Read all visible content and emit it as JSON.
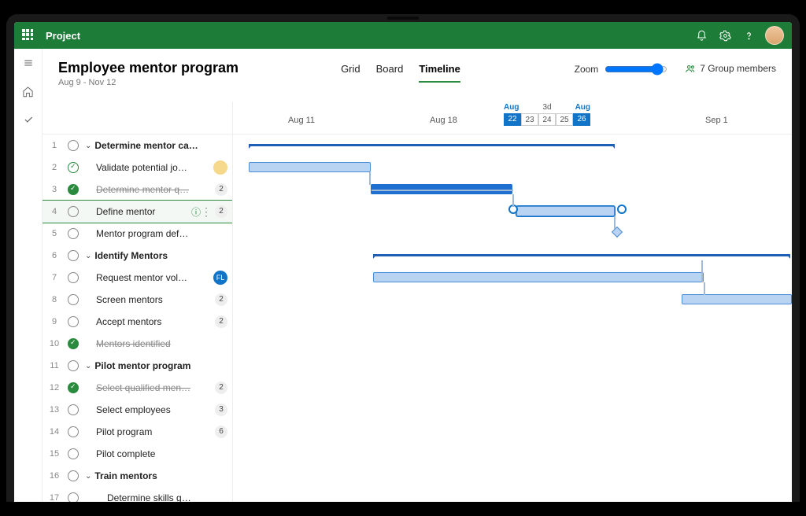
{
  "app": {
    "name": "Project"
  },
  "header": {
    "title": "Employee mentor program",
    "date_range": "Aug 9 - Nov 12",
    "zoom_label": "Zoom",
    "group_members": "7 Group members"
  },
  "views": {
    "grid": "Grid",
    "board": "Board",
    "timeline": "Timeline",
    "active": "timeline"
  },
  "timeline": {
    "label_aug11": "Aug 11",
    "label_aug18": "Aug 18",
    "label_sep1": "Sep 1",
    "range": {
      "lbl_aug_l": "Aug",
      "lbl_mid": "3d",
      "lbl_aug_r": "Aug",
      "d22": "22",
      "d23": "23",
      "d24": "24",
      "d25": "25",
      "d26": "26"
    }
  },
  "tasks": [
    {
      "n": "1",
      "name": "Determine mentor ca…",
      "status": "open",
      "bold": true,
      "chev": true,
      "indent": 1
    },
    {
      "n": "2",
      "name": "Validate potential jo…",
      "status": "donelight",
      "indent": 2,
      "avatar": "y"
    },
    {
      "n": "3",
      "name": "Determine mentor q…",
      "status": "done",
      "struck": true,
      "indent": 2,
      "badge": "2"
    },
    {
      "n": "4",
      "name": "Define mentor",
      "status": "open",
      "indent": 2,
      "badge": "2",
      "selected": true,
      "info": true,
      "more": true
    },
    {
      "n": "5",
      "name": "Mentor program def…",
      "status": "open",
      "indent": 2
    },
    {
      "n": "6",
      "name": "Identify Mentors",
      "status": "open",
      "bold": true,
      "chev": true,
      "indent": 1
    },
    {
      "n": "7",
      "name": "Request mentor vol…",
      "status": "open",
      "indent": 2,
      "avatar": "FL"
    },
    {
      "n": "8",
      "name": "Screen mentors",
      "status": "open",
      "indent": 2,
      "badge": "2"
    },
    {
      "n": "9",
      "name": "Accept mentors",
      "status": "open",
      "indent": 2,
      "badge": "2"
    },
    {
      "n": "10",
      "name": "Mentors identified",
      "status": "done",
      "struck": true,
      "indent": 2
    },
    {
      "n": "11",
      "name": "Pilot mentor program",
      "status": "open",
      "bold": true,
      "chev": true,
      "indent": 1
    },
    {
      "n": "12",
      "name": "Select qualified men…",
      "status": "done",
      "struck": true,
      "indent": 2,
      "badge": "2"
    },
    {
      "n": "13",
      "name": "Select employees",
      "status": "open",
      "indent": 2,
      "badge": "3"
    },
    {
      "n": "14",
      "name": "Pilot program",
      "status": "open",
      "indent": 2,
      "badge": "6"
    },
    {
      "n": "15",
      "name": "Pilot complete",
      "status": "open",
      "indent": 2
    },
    {
      "n": "16",
      "name": "Train mentors",
      "status": "open",
      "bold": true,
      "chev": true,
      "indent": 1
    },
    {
      "n": "17",
      "name": "Determine skills g…",
      "status": "open",
      "indent": 3
    }
  ]
}
